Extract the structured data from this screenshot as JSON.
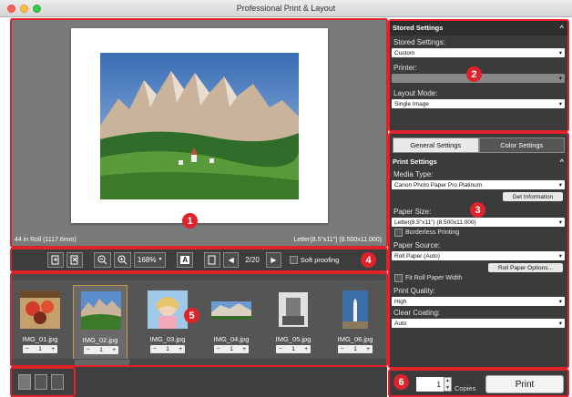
{
  "window": {
    "title": "Professional Print & Layout"
  },
  "preview": {
    "roll_label": "44 in Roll (1117.6mm)",
    "size_label": "Letter(8.5\"x11\") (8.500x11.000)"
  },
  "toolbar": {
    "zoom_value": "168%",
    "page_counter": "2/20",
    "soft_proofing": "Soft proofing",
    "text_tool_label": "A"
  },
  "thumbnails": [
    {
      "name": "IMG_01.jpg",
      "copies": "1"
    },
    {
      "name": "IMG_02.jpg",
      "copies": "1"
    },
    {
      "name": "IMG_03.jpg",
      "copies": "1"
    },
    {
      "name": "IMG_04.jpg",
      "copies": "1"
    },
    {
      "name": "IMG_05.jpg",
      "copies": "1"
    },
    {
      "name": "IMG_06.jpg",
      "copies": "1"
    }
  ],
  "stored_settings": {
    "header": "Stored Settings",
    "stored_label": "Stored Settings:",
    "stored_value": "Custom",
    "printer_label": "Printer:",
    "layout_label": "Layout Mode:",
    "layout_value": "Single Image"
  },
  "general_settings": {
    "tab_general": "General Settings",
    "tab_color": "Color Settings",
    "print_settings_header": "Print Settings",
    "media_type_label": "Media Type:",
    "media_type_value": "Canon Photo Paper Pro Platinum",
    "get_information": "Get Information",
    "paper_size_label": "Paper Size:",
    "paper_size_value": "Letter(8.5\"x11\") (8.500x11.000)",
    "borderless_label": "Borderless Printing",
    "paper_source_label": "Paper Source:",
    "paper_source_value": "Roll Paper (Auto)",
    "roll_paper_options": "Roll Paper Options...",
    "fit_roll_label": "Fit Roll Paper Width",
    "print_quality_label": "Print Quality:",
    "print_quality_value": "High",
    "clear_coating_label": "Clear Coating:",
    "clear_coating_value": "Auto"
  },
  "print_bar": {
    "copies_value": "1",
    "copies_label": "Copies",
    "print_button": "Print"
  },
  "callouts": {
    "c1": "1",
    "c2": "2",
    "c3": "3",
    "c4": "4",
    "c5": "5",
    "c6": "6"
  },
  "colors": {
    "callout_red": "#e0222a",
    "panel_dark": "#3b3b3b",
    "preview_gray": "#7a7a7a",
    "selection_gold": "#c79a4a"
  }
}
